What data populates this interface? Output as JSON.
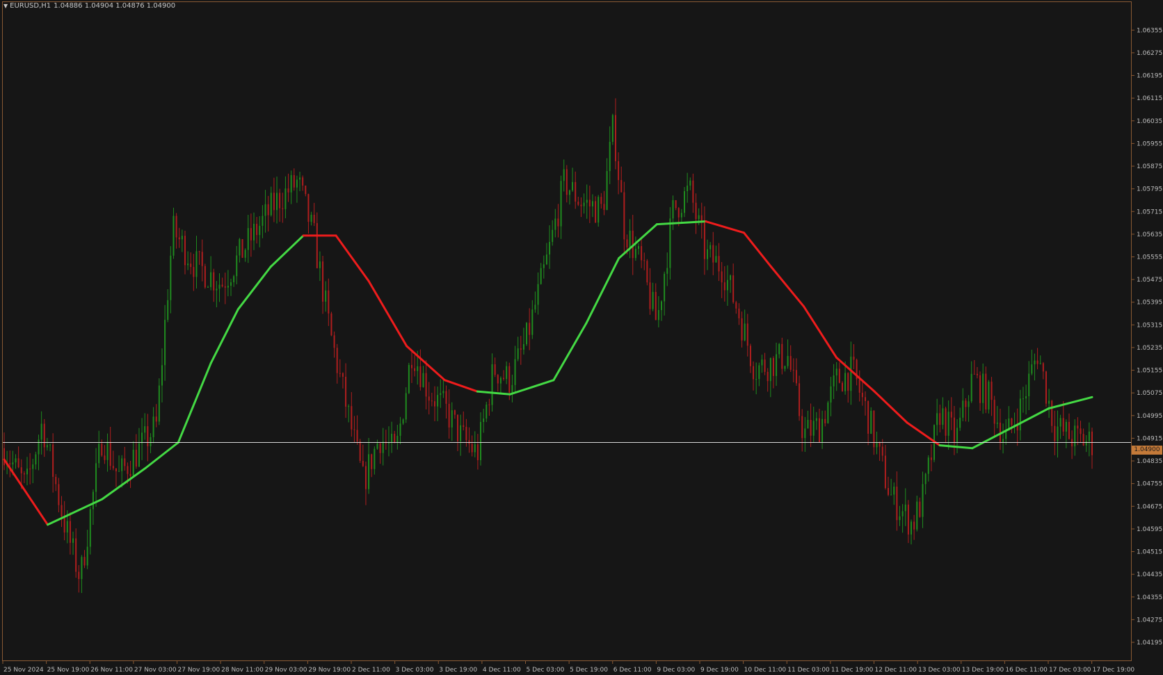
{
  "chart_header": {
    "symbol_timeframe": "EURUSD,H1",
    "ohlc": "1.04886 1.04904 1.04876 1.04900",
    "dropdown_icon": "triangle-down-icon"
  },
  "current_price_label": "1.04900",
  "colors": {
    "background": "#161616",
    "frame": "#8a5a34",
    "bull_candle": "#1f8c1f",
    "bear_candle": "#b01e1e",
    "ma_rising": "#44d944",
    "ma_falling": "#ee1c1c",
    "price_line": "#d9d9d9",
    "price_tag": "#c47a39",
    "axis_text": "#bfbfbf"
  },
  "chart_data": {
    "type": "candlestick",
    "symbol": "EURUSD",
    "timeframe": "H1",
    "ylim": [
      1.04195,
      1.06395
    ],
    "price_ticks": [
      "1.06355",
      "1.06275",
      "1.06195",
      "1.06115",
      "1.06035",
      "1.05955",
      "1.05875",
      "1.05795",
      "1.05715",
      "1.05635",
      "1.05555",
      "1.05475",
      "1.05395",
      "1.05315",
      "1.05235",
      "1.05155",
      "1.05075",
      "1.04995",
      "1.04915",
      "1.04835",
      "1.04755",
      "1.04675",
      "1.04595",
      "1.04515",
      "1.04435",
      "1.04355",
      "1.04275",
      "1.04195"
    ],
    "time_labels": [
      "25 Nov 2024",
      "25 Nov 19:00",
      "26 Nov 11:00",
      "27 Nov 03:00",
      "27 Nov 19:00",
      "28 Nov 11:00",
      "29 Nov 03:00",
      "29 Nov 19:00",
      "2 Dec 11:00",
      "3 Dec 03:00",
      "3 Dec 19:00",
      "4 Dec 11:00",
      "5 Dec 03:00",
      "5 Dec 19:00",
      "6 Dec 11:00",
      "9 Dec 03:00",
      "9 Dec 19:00",
      "10 Dec 11:00",
      "11 Dec 03:00",
      "11 Dec 19:00",
      "12 Dec 11:00",
      "13 Dec 03:00",
      "13 Dec 19:00",
      "16 Dec 11:00",
      "17 Dec 03:00",
      "17 Dec 19:00"
    ],
    "current_price": 1.049,
    "price_path": [
      {
        "t": 0,
        "p": 1.0488
      },
      {
        "t": 0.02,
        "p": 1.0474
      },
      {
        "t": 0.035,
        "p": 1.0497
      },
      {
        "t": 0.055,
        "p": 1.0462
      },
      {
        "t": 0.07,
        "p": 1.0442
      },
      {
        "t": 0.09,
        "p": 1.0492
      },
      {
        "t": 0.105,
        "p": 1.0478
      },
      {
        "t": 0.125,
        "p": 1.0488
      },
      {
        "t": 0.14,
        "p": 1.0496
      },
      {
        "t": 0.155,
        "p": 1.0565
      },
      {
        "t": 0.175,
        "p": 1.0553
      },
      {
        "t": 0.2,
        "p": 1.0546
      },
      {
        "t": 0.225,
        "p": 1.0561
      },
      {
        "t": 0.25,
        "p": 1.0575
      },
      {
        "t": 0.27,
        "p": 1.0582
      },
      {
        "t": 0.285,
        "p": 1.0562
      },
      {
        "t": 0.3,
        "p": 1.0528
      },
      {
        "t": 0.315,
        "p": 1.0502
      },
      {
        "t": 0.33,
        "p": 1.0476
      },
      {
        "t": 0.345,
        "p": 1.0492
      },
      {
        "t": 0.36,
        "p": 1.0486
      },
      {
        "t": 0.375,
        "p": 1.0523
      },
      {
        "t": 0.39,
        "p": 1.0508
      },
      {
        "t": 0.405,
        "p": 1.0502
      },
      {
        "t": 0.42,
        "p": 1.0492
      },
      {
        "t": 0.435,
        "p": 1.0486
      },
      {
        "t": 0.45,
        "p": 1.0516
      },
      {
        "t": 0.465,
        "p": 1.0512
      },
      {
        "t": 0.48,
        "p": 1.0526
      },
      {
        "t": 0.5,
        "p": 1.0556
      },
      {
        "t": 0.515,
        "p": 1.0582
      },
      {
        "t": 0.53,
        "p": 1.0575
      },
      {
        "t": 0.55,
        "p": 1.0572
      },
      {
        "t": 0.56,
        "p": 1.0602
      },
      {
        "t": 0.57,
        "p": 1.0566
      },
      {
        "t": 0.585,
        "p": 1.0553
      },
      {
        "t": 0.6,
        "p": 1.0532
      },
      {
        "t": 0.615,
        "p": 1.0572
      },
      {
        "t": 0.63,
        "p": 1.0579
      },
      {
        "t": 0.645,
        "p": 1.0556
      },
      {
        "t": 0.66,
        "p": 1.0552
      },
      {
        "t": 0.675,
        "p": 1.0536
      },
      {
        "t": 0.69,
        "p": 1.0516
      },
      {
        "t": 0.705,
        "p": 1.0518
      },
      {
        "t": 0.72,
        "p": 1.0521
      },
      {
        "t": 0.735,
        "p": 1.0493
      },
      {
        "t": 0.75,
        "p": 1.0496
      },
      {
        "t": 0.765,
        "p": 1.0512
      },
      {
        "t": 0.78,
        "p": 1.0515
      },
      {
        "t": 0.795,
        "p": 1.0498
      },
      {
        "t": 0.805,
        "p": 1.0484
      },
      {
        "t": 0.815,
        "p": 1.0471
      },
      {
        "t": 0.825,
        "p": 1.0466
      },
      {
        "t": 0.835,
        "p": 1.0461
      },
      {
        "t": 0.845,
        "p": 1.0471
      },
      {
        "t": 0.86,
        "p": 1.0501
      },
      {
        "t": 0.875,
        "p": 1.0491
      },
      {
        "t": 0.89,
        "p": 1.0513
      },
      {
        "t": 0.905,
        "p": 1.0506
      },
      {
        "t": 0.92,
        "p": 1.0491
      },
      {
        "t": 0.935,
        "p": 1.0503
      },
      {
        "t": 0.95,
        "p": 1.0522
      },
      {
        "t": 0.965,
        "p": 1.0496
      },
      {
        "t": 0.98,
        "p": 1.0492
      },
      {
        "t": 1,
        "p": 1.049
      }
    ],
    "moving_average": {
      "name": "",
      "points": [
        {
          "t": 0,
          "p": 1.0484,
          "dir": "down"
        },
        {
          "t": 0.04,
          "p": 1.0461,
          "dir": "down"
        },
        {
          "t": 0.09,
          "p": 1.047,
          "dir": "up"
        },
        {
          "t": 0.13,
          "p": 1.0481,
          "dir": "up"
        },
        {
          "t": 0.16,
          "p": 1.049,
          "dir": "up"
        },
        {
          "t": 0.19,
          "p": 1.0518,
          "dir": "up"
        },
        {
          "t": 0.215,
          "p": 1.0537,
          "dir": "up"
        },
        {
          "t": 0.245,
          "p": 1.0552,
          "dir": "up"
        },
        {
          "t": 0.275,
          "p": 1.0563,
          "dir": "up"
        },
        {
          "t": 0.305,
          "p": 1.0563,
          "dir": "down"
        },
        {
          "t": 0.335,
          "p": 1.0547,
          "dir": "down"
        },
        {
          "t": 0.37,
          "p": 1.0524,
          "dir": "down"
        },
        {
          "t": 0.405,
          "p": 1.0512,
          "dir": "down"
        },
        {
          "t": 0.435,
          "p": 1.0508,
          "dir": "down"
        },
        {
          "t": 0.465,
          "p": 1.0507,
          "dir": "up"
        },
        {
          "t": 0.505,
          "p": 1.0512,
          "dir": "up"
        },
        {
          "t": 0.535,
          "p": 1.0532,
          "dir": "up"
        },
        {
          "t": 0.565,
          "p": 1.0555,
          "dir": "up"
        },
        {
          "t": 0.6,
          "p": 1.0567,
          "dir": "up"
        },
        {
          "t": 0.645,
          "p": 1.0568,
          "dir": "up"
        },
        {
          "t": 0.68,
          "p": 1.0564,
          "dir": "down"
        },
        {
          "t": 0.705,
          "p": 1.0552,
          "dir": "down"
        },
        {
          "t": 0.735,
          "p": 1.0538,
          "dir": "down"
        },
        {
          "t": 0.765,
          "p": 1.052,
          "dir": "down"
        },
        {
          "t": 0.8,
          "p": 1.0508,
          "dir": "down"
        },
        {
          "t": 0.83,
          "p": 1.0497,
          "dir": "down"
        },
        {
          "t": 0.86,
          "p": 1.0489,
          "dir": "down"
        },
        {
          "t": 0.89,
          "p": 1.0488,
          "dir": "up"
        },
        {
          "t": 0.92,
          "p": 1.0494,
          "dir": "up"
        },
        {
          "t": 0.96,
          "p": 1.0502,
          "dir": "up"
        },
        {
          "t": 1,
          "p": 1.0506,
          "dir": "up"
        }
      ]
    },
    "grid": false
  }
}
